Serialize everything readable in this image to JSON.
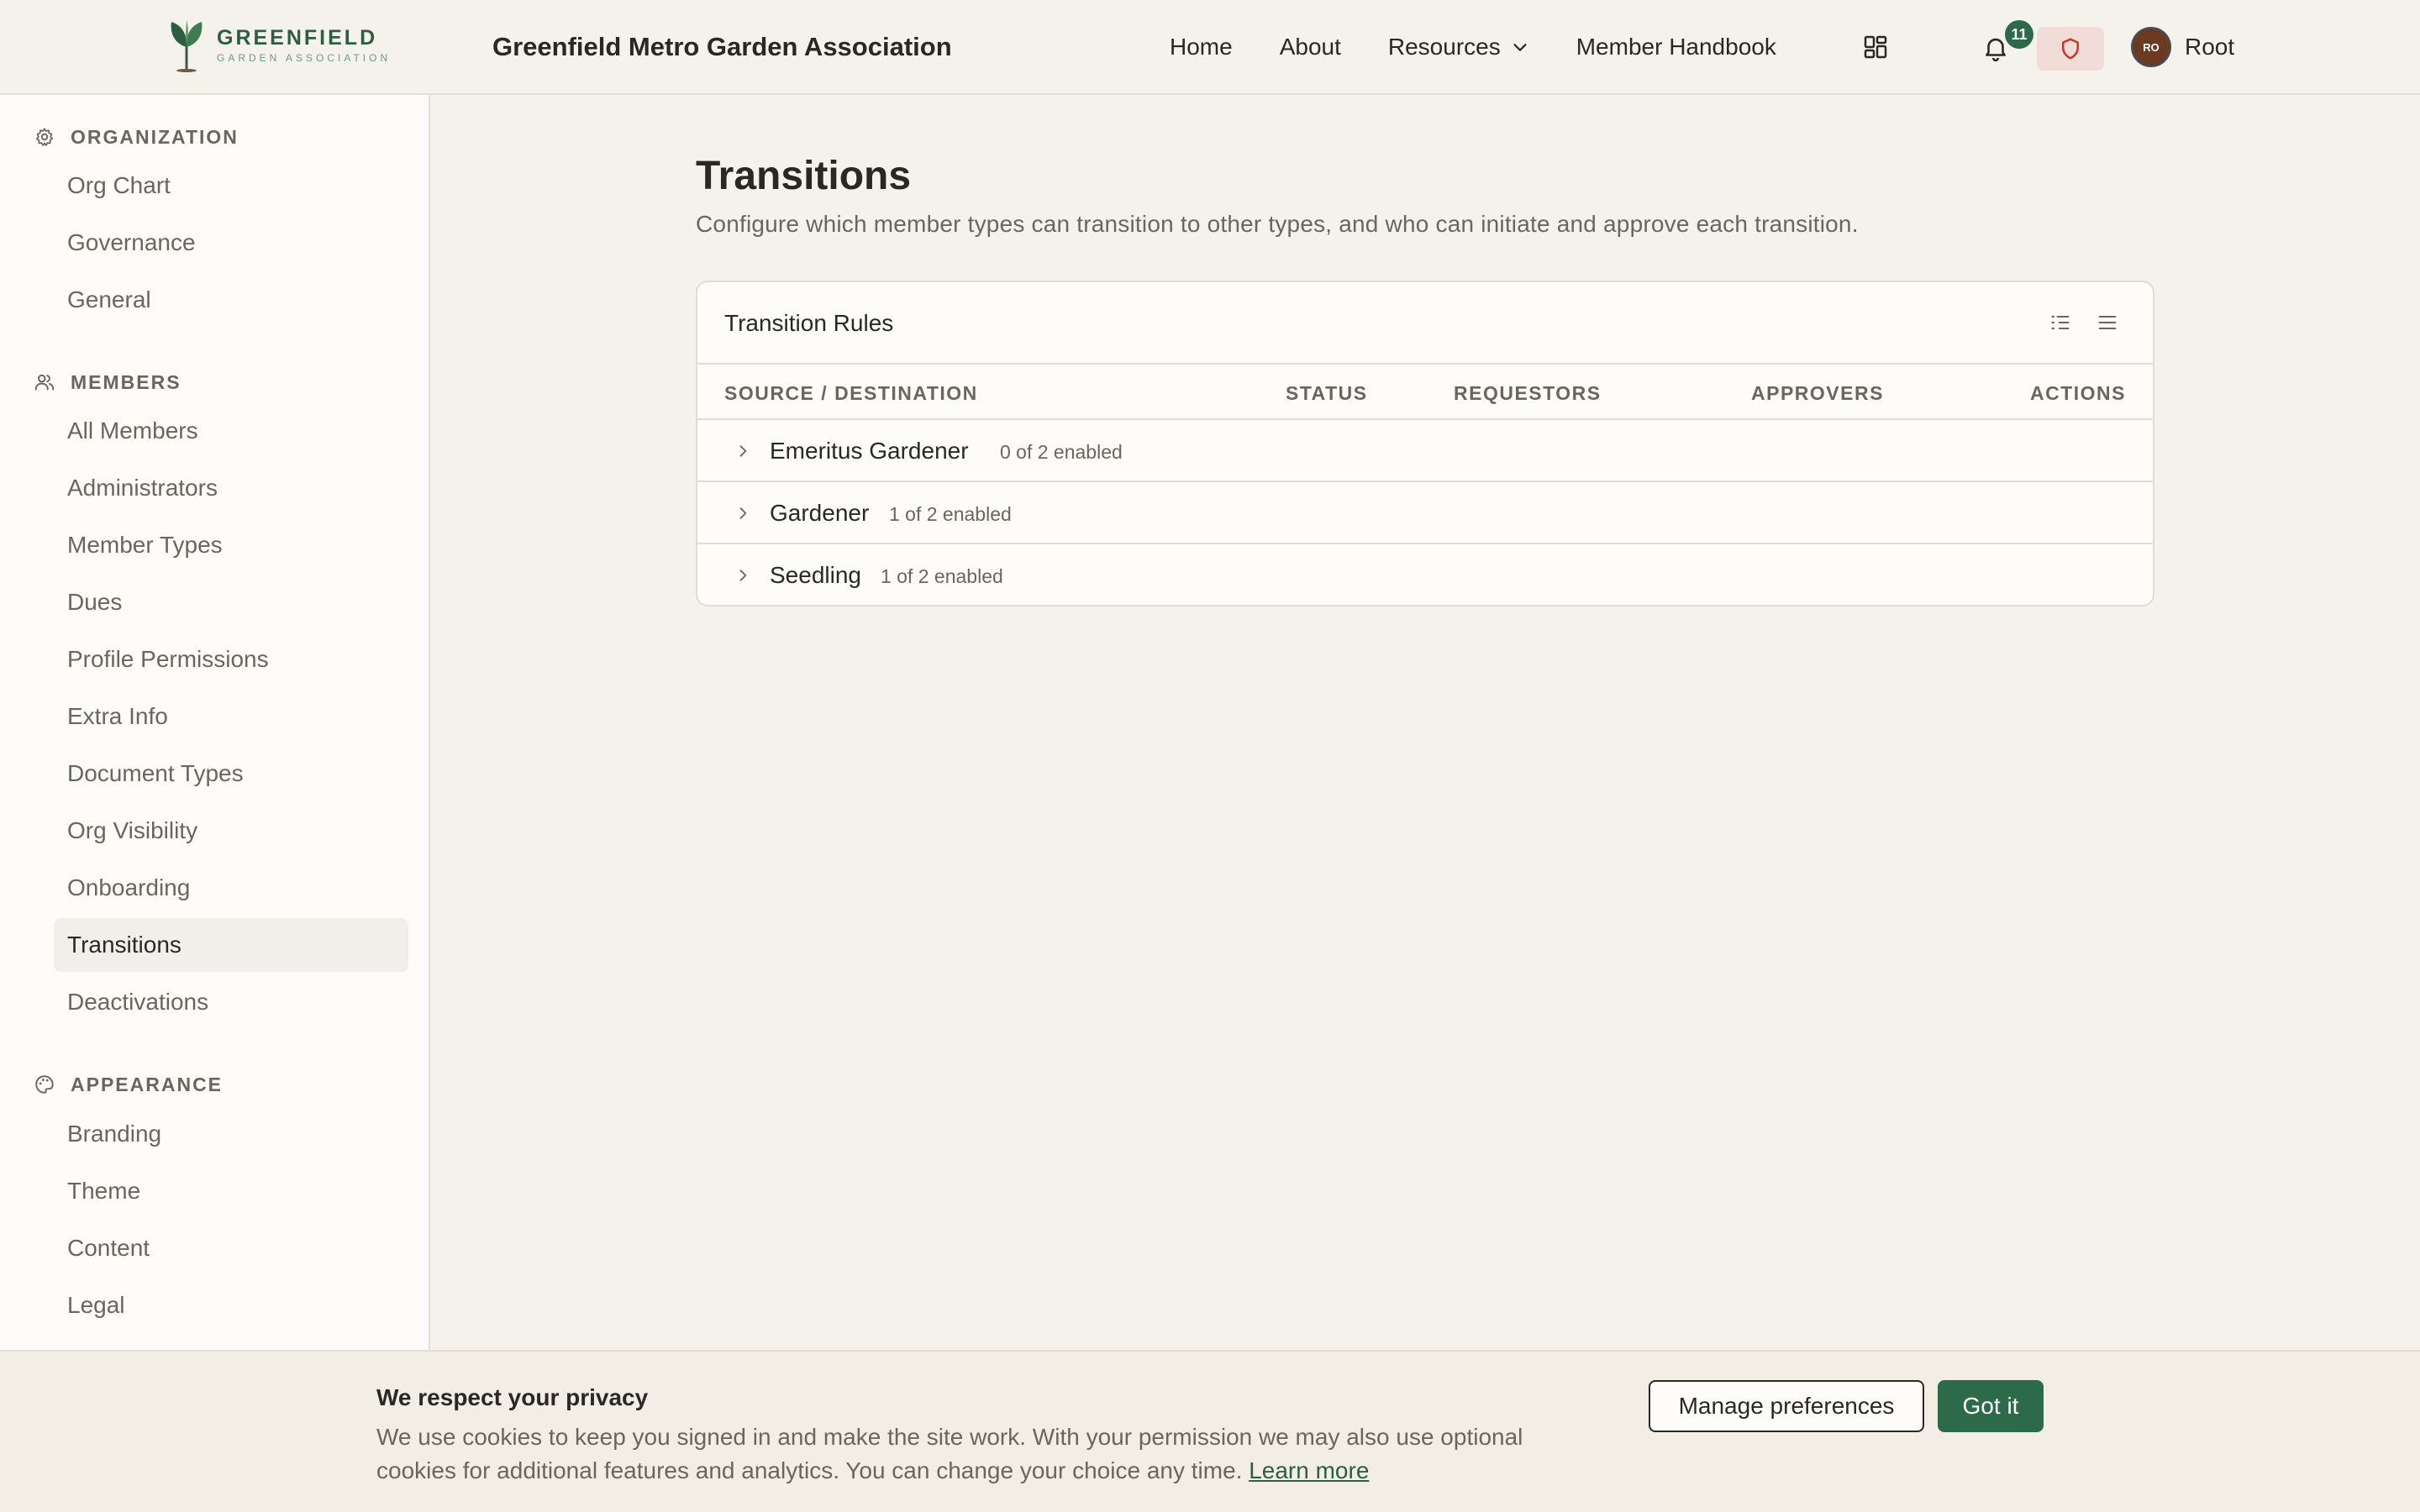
{
  "header": {
    "logo_main": "GREENFIELD",
    "logo_sub": "GARDEN ASSOCIATION",
    "site_title": "Greenfield Metro Garden Association",
    "nav": [
      {
        "label": "Home"
      },
      {
        "label": "About"
      },
      {
        "label": "Resources"
      },
      {
        "label": "Member Handbook"
      }
    ],
    "notification_count": "11",
    "avatar_initials": "RO",
    "user_name": "Root",
    "icons": {
      "apps": "apps-grid-icon",
      "bell": "bell-icon",
      "shield": "shield-icon",
      "resources_chevron": "chevron-down-icon"
    },
    "colors": {
      "brand_green": "#2c6a4a",
      "shield_bg": "#f2dcd8",
      "shield_stroke": "#c0392b"
    }
  },
  "sidebar": {
    "sections": [
      {
        "title": "ORGANIZATION",
        "icon": "gear-icon",
        "items": [
          "Org Chart",
          "Governance",
          "General"
        ]
      },
      {
        "title": "MEMBERS",
        "icon": "users-icon",
        "items": [
          "All Members",
          "Administrators",
          "Member Types",
          "Dues",
          "Profile Permissions",
          "Extra Info",
          "Document Types",
          "Org Visibility",
          "Onboarding",
          "Transitions",
          "Deactivations"
        ]
      },
      {
        "title": "APPEARANCE",
        "icon": "palette-icon",
        "items": [
          "Branding",
          "Theme",
          "Content",
          "Legal"
        ]
      }
    ],
    "active_item": "Transitions"
  },
  "main": {
    "title": "Transitions",
    "description": "Configure which member types can transition to other types, and who can initiate and approve each transition.",
    "card": {
      "title": "Transition Rules",
      "toolbar_icons": [
        "list-indent-icon",
        "list-icon"
      ],
      "columns": [
        "SOURCE / DESTINATION",
        "STATUS",
        "REQUESTORS",
        "APPROVERS",
        "ACTIONS"
      ],
      "rows": [
        {
          "name": "Emeritus Gardener",
          "count": "0 of 2 enabled"
        },
        {
          "name": "Gardener",
          "count": "1 of 2 enabled"
        },
        {
          "name": "Seedling",
          "count": "1 of 2 enabled"
        }
      ]
    }
  },
  "cookie": {
    "title": "We respect your privacy",
    "text": "We use cookies to keep you signed in and make the site work. With your permission we may also use optional cookies for additional features and analytics. You can change your choice any time.",
    "link": "Learn more",
    "manage_label": "Manage preferences",
    "accept_label": "Got it"
  }
}
